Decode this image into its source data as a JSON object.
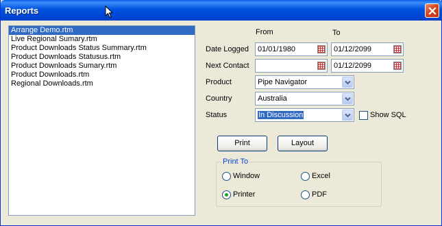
{
  "window": {
    "title": "Reports"
  },
  "report_list": [
    {
      "label": "Arrange Demo.rtm",
      "selected": true
    },
    {
      "label": "Live Regional Sumary.rtm",
      "selected": false
    },
    {
      "label": "Product Downloads Status Summary.rtm",
      "selected": false
    },
    {
      "label": "Product Downloads Statusus.rtm",
      "selected": false
    },
    {
      "label": "Product Downloads Sumary.rtm",
      "selected": false
    },
    {
      "label": "Product Downloads.rtm",
      "selected": false
    },
    {
      "label": "Regional Downloads.rtm",
      "selected": false
    }
  ],
  "headers": {
    "from": "From",
    "to": "To"
  },
  "date_logged": {
    "label": "Date Logged",
    "from": "01/01/1980",
    "to": "01/12/2099"
  },
  "next_contact": {
    "label": "Next Contact",
    "from": "",
    "to": "01/12/2099"
  },
  "product": {
    "label": "Product",
    "value": "Pipe Navigator"
  },
  "country": {
    "label": "Country",
    "value": "Australia"
  },
  "status": {
    "label": "Status",
    "value": "In Discussion"
  },
  "show_sql": {
    "label": "Show SQL",
    "checked": false
  },
  "buttons": {
    "print": "Print",
    "layout": "Layout"
  },
  "print_to": {
    "legend": "Print To",
    "options": [
      {
        "label": "Window",
        "checked": false
      },
      {
        "label": "Excel",
        "checked": false
      },
      {
        "label": "Printer",
        "checked": true
      },
      {
        "label": "PDF",
        "checked": false
      }
    ]
  }
}
